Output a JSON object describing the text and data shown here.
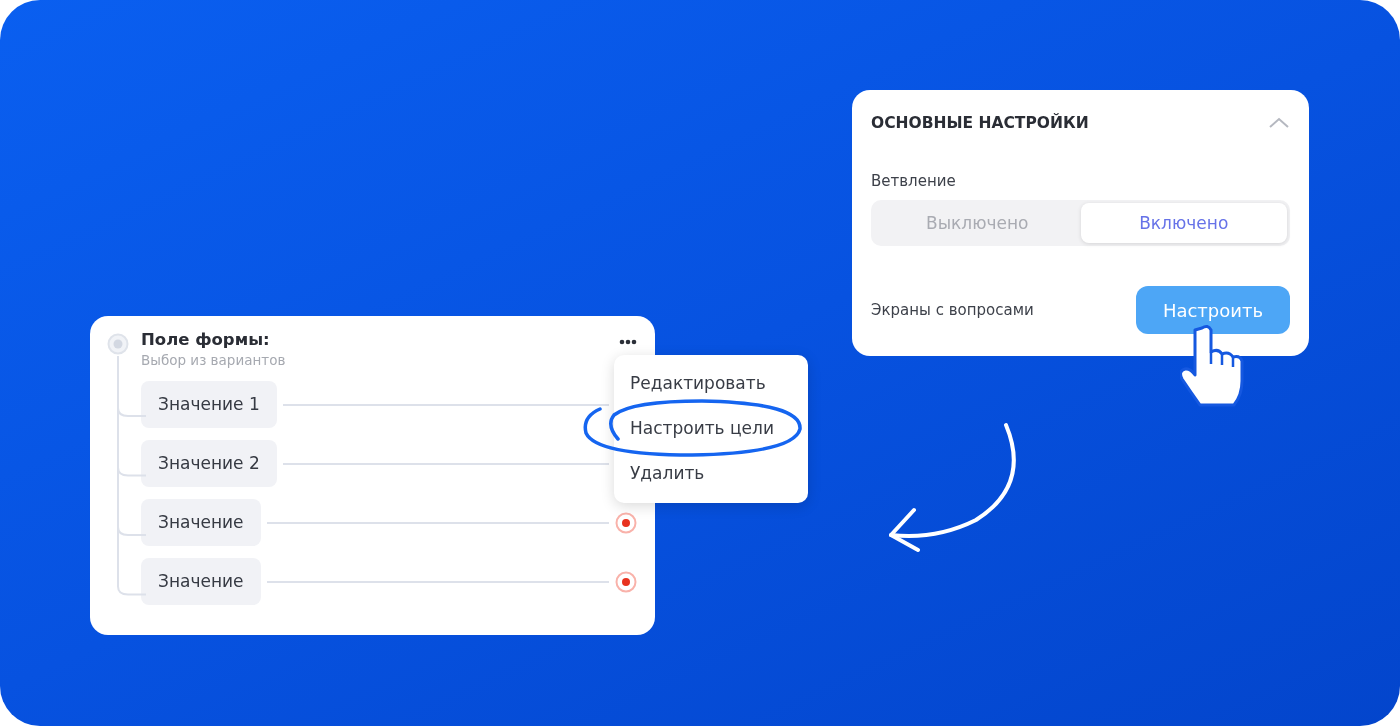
{
  "settings_panel": {
    "title": "ОСНОВНЫЕ НАСТРОЙКИ",
    "expanded": true,
    "branching_label": "Ветвление",
    "toggle": [
      {
        "label": "Выключено",
        "selected": false
      },
      {
        "label": "Включено",
        "selected": true
      }
    ],
    "screens_label": "Экраны с вопросами",
    "configure_button": "Настроить"
  },
  "form_field": {
    "title": "Поле формы:",
    "subtitle": "Выбор из вариантов",
    "options": [
      {
        "label": "Значение 1"
      },
      {
        "label": "Значение 2"
      },
      {
        "label": "Значение",
        "marker": true
      },
      {
        "label": "Значение",
        "marker": true
      }
    ]
  },
  "context_menu": {
    "items": [
      {
        "label": "Редактировать",
        "highlighted": false
      },
      {
        "label": "Настроить цели",
        "highlighted": true
      },
      {
        "label": "Удалить",
        "highlighted": false
      }
    ]
  }
}
